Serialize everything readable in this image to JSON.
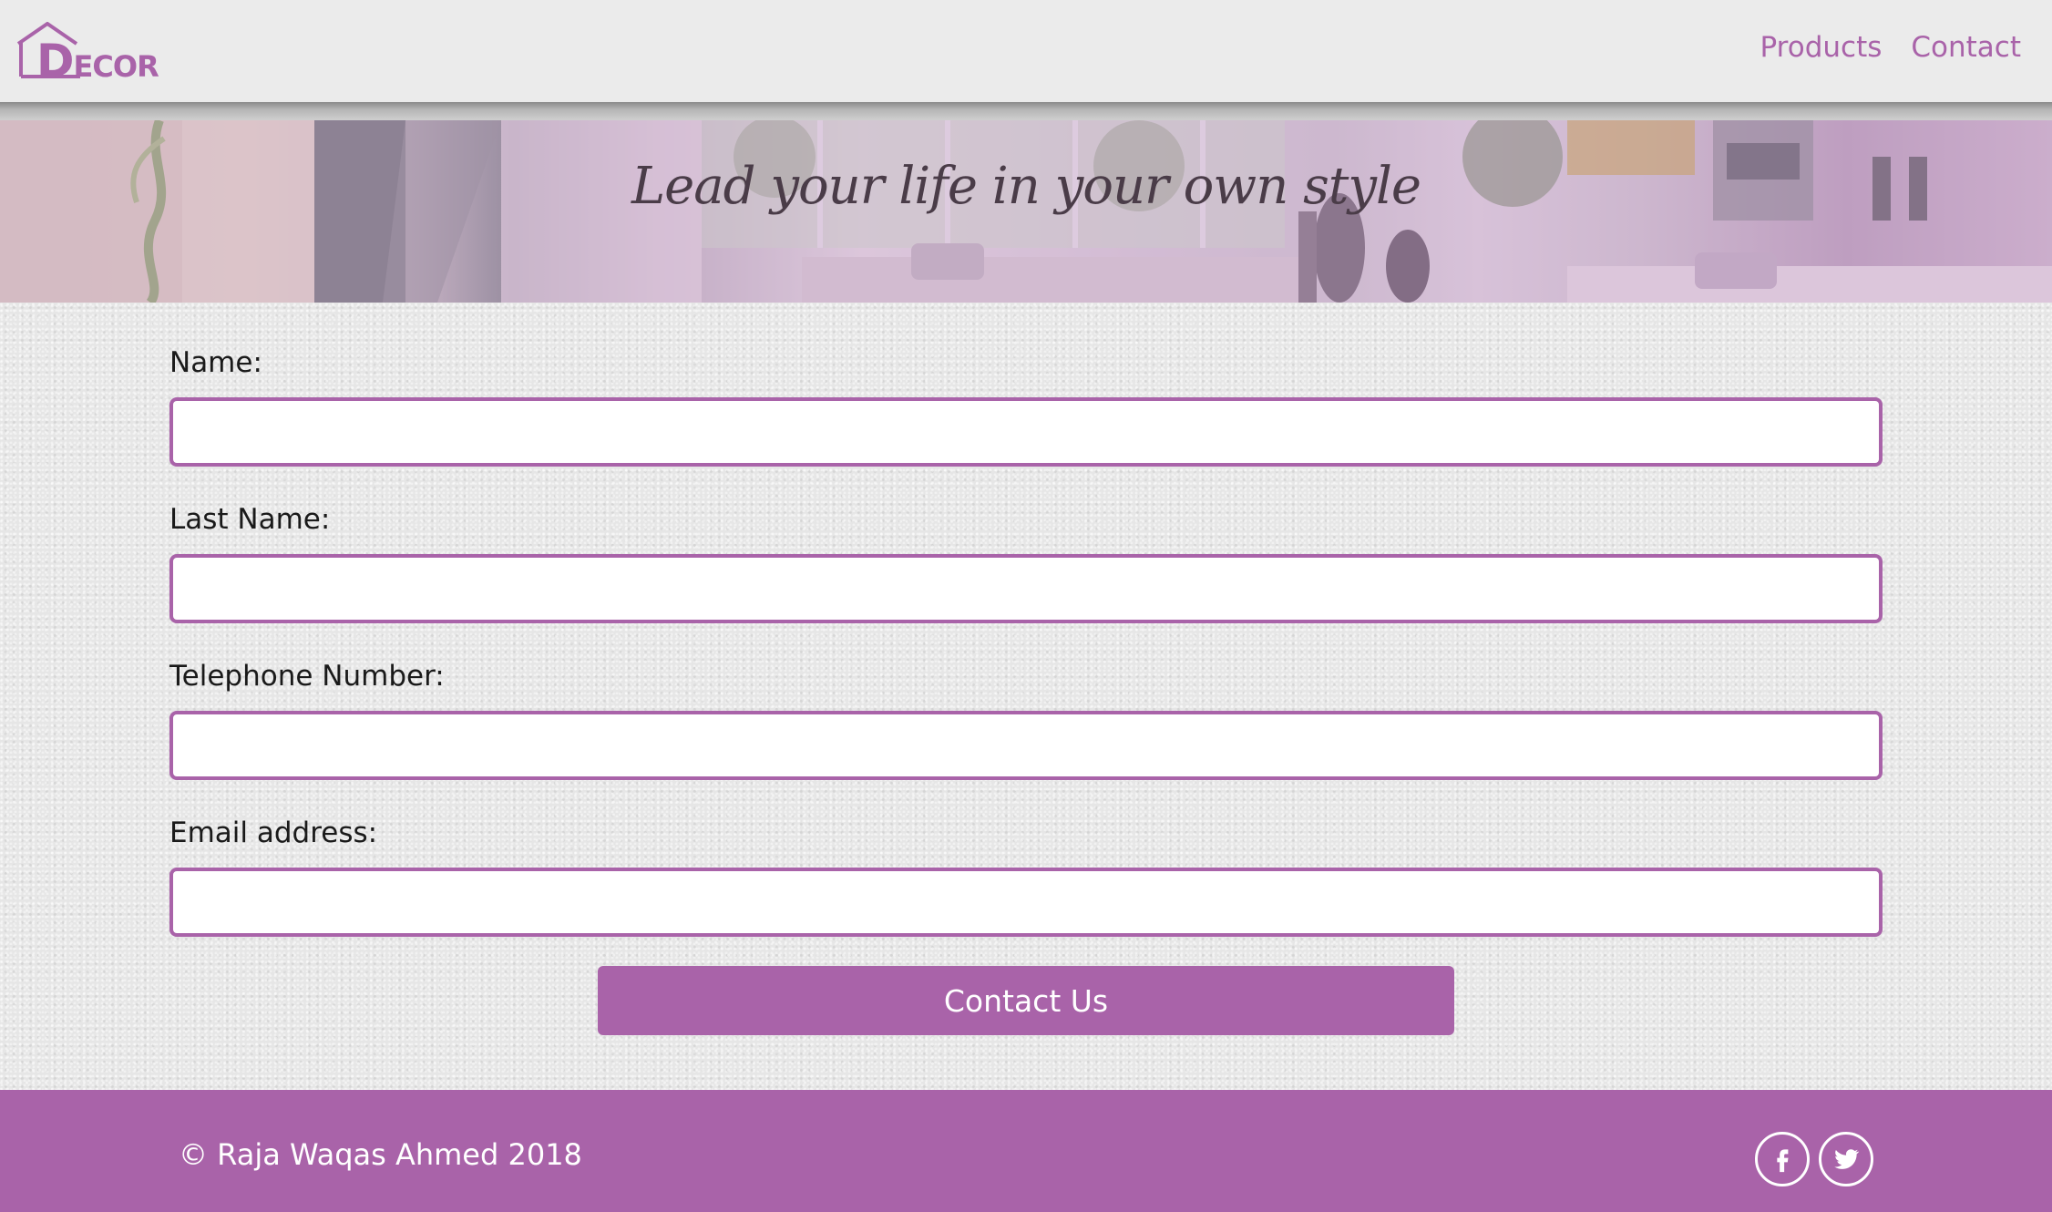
{
  "header": {
    "logo": {
      "letter": "D",
      "rest": "ECOR"
    },
    "nav": [
      {
        "label": "Products"
      },
      {
        "label": "Contact"
      }
    ]
  },
  "banner": {
    "tagline": "Lead your life in your own style"
  },
  "form": {
    "fields": [
      {
        "label": "Name:",
        "value": ""
      },
      {
        "label": "Last Name:",
        "value": ""
      },
      {
        "label": "Telephone Number:",
        "value": ""
      },
      {
        "label": "Email address:",
        "value": ""
      }
    ],
    "submit_label": "Contact Us"
  },
  "footer": {
    "copyright": "© Raja Waqas Ahmed 2018",
    "social": [
      {
        "icon": "facebook-icon"
      },
      {
        "icon": "twitter-icon"
      }
    ]
  },
  "colors": {
    "accent": "#a963a9",
    "header_bg": "#ebebeb",
    "body_bg": "#e6e6e6",
    "footer_bg": "#a963a9"
  }
}
